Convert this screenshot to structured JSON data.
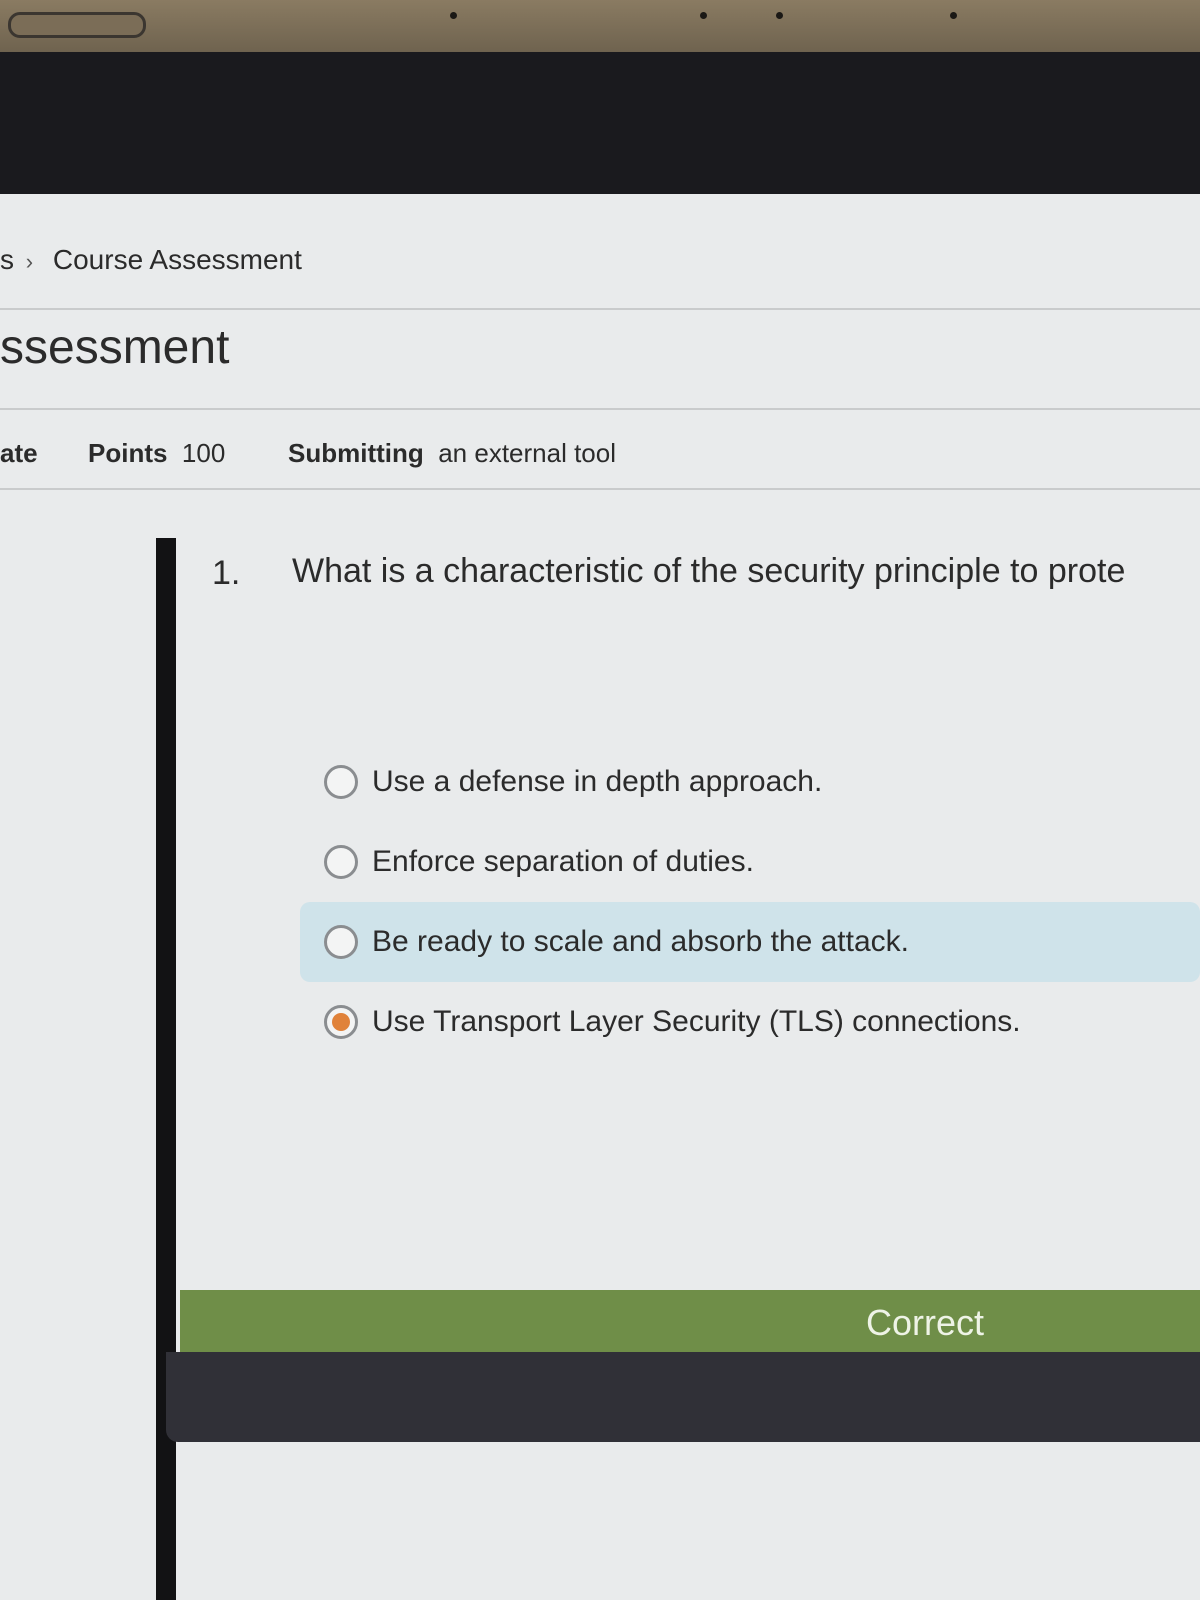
{
  "breadcrumb": {
    "prev_fragment": "s",
    "separator": "›",
    "current": "Course Assessment"
  },
  "page": {
    "title": "ssessment"
  },
  "meta": {
    "cut_label": "ate",
    "points_label": "Points",
    "points_value": "100",
    "submitting_label": "Submitting",
    "submitting_value": "an external tool"
  },
  "question": {
    "number": "1.",
    "text": "What is a characteristic of the security principle to prote",
    "options": [
      {
        "label": "Use a defense in depth approach.",
        "selected": false
      },
      {
        "label": "Enforce separation of duties.",
        "selected": false
      },
      {
        "label": "Be ready to scale and absorb the attack.",
        "selected": false,
        "hovered": true
      },
      {
        "label": "Use Transport Layer Security (TLS) connections.",
        "selected": true
      }
    ]
  },
  "result": {
    "text": "Correct"
  },
  "colors": {
    "accent_selected": "#e0823a",
    "result_bar": "#6f8e48",
    "hover_bg": "#cfe3ea"
  }
}
